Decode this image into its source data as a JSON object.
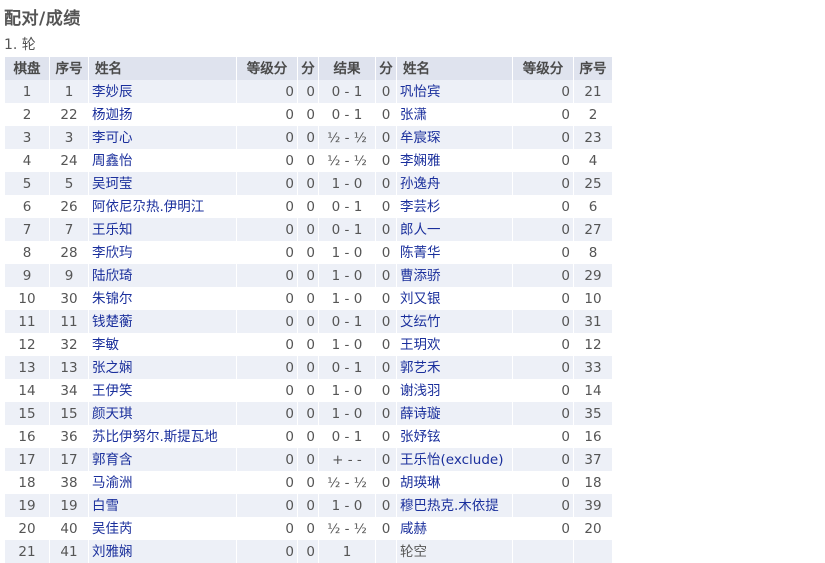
{
  "page_title": "配对/成绩",
  "round_label": "1. 轮",
  "headers": [
    "棋盘",
    "序号",
    "姓名",
    "等级分",
    "分",
    "结果",
    "分",
    "姓名",
    "等级分",
    "序号"
  ],
  "rows": [
    {
      "board": "1",
      "no1": "1",
      "name1": "李妙辰",
      "rating1": "0",
      "pts1": "0",
      "result": "0 - 1",
      "pts2": "0",
      "name2": "巩怡宾",
      "rating2": "0",
      "no2": "21"
    },
    {
      "board": "2",
      "no1": "22",
      "name1": "杨迦扬",
      "rating1": "0",
      "pts1": "0",
      "result": "0 - 1",
      "pts2": "0",
      "name2": "张潇",
      "rating2": "0",
      "no2": "2"
    },
    {
      "board": "3",
      "no1": "3",
      "name1": "李可心",
      "rating1": "0",
      "pts1": "0",
      "result": "½ - ½",
      "pts2": "0",
      "name2": "牟宸琛",
      "rating2": "0",
      "no2": "23"
    },
    {
      "board": "4",
      "no1": "24",
      "name1": "周鑫怡",
      "rating1": "0",
      "pts1": "0",
      "result": "½ - ½",
      "pts2": "0",
      "name2": "李娴雅",
      "rating2": "0",
      "no2": "4"
    },
    {
      "board": "5",
      "no1": "5",
      "name1": "吴珂莹",
      "rating1": "0",
      "pts1": "0",
      "result": "1 - 0",
      "pts2": "0",
      "name2": "孙逸舟",
      "rating2": "0",
      "no2": "25"
    },
    {
      "board": "6",
      "no1": "26",
      "name1": "阿依尼尕热.伊明江",
      "rating1": "0",
      "pts1": "0",
      "result": "0 - 1",
      "pts2": "0",
      "name2": "李芸杉",
      "rating2": "0",
      "no2": "6"
    },
    {
      "board": "7",
      "no1": "7",
      "name1": "王乐知",
      "rating1": "0",
      "pts1": "0",
      "result": "0 - 1",
      "pts2": "0",
      "name2": "郎人一",
      "rating2": "0",
      "no2": "27"
    },
    {
      "board": "8",
      "no1": "28",
      "name1": "李欣玙",
      "rating1": "0",
      "pts1": "0",
      "result": "1 - 0",
      "pts2": "0",
      "name2": "陈菁华",
      "rating2": "0",
      "no2": "8"
    },
    {
      "board": "9",
      "no1": "9",
      "name1": "陆欣琦",
      "rating1": "0",
      "pts1": "0",
      "result": "1 - 0",
      "pts2": "0",
      "name2": "曹添骄",
      "rating2": "0",
      "no2": "29"
    },
    {
      "board": "10",
      "no1": "30",
      "name1": "朱锦尔",
      "rating1": "0",
      "pts1": "0",
      "result": "1 - 0",
      "pts2": "0",
      "name2": "刘又银",
      "rating2": "0",
      "no2": "10"
    },
    {
      "board": "11",
      "no1": "11",
      "name1": "钱楚蘅",
      "rating1": "0",
      "pts1": "0",
      "result": "0 - 1",
      "pts2": "0",
      "name2": "艾纭竹",
      "rating2": "0",
      "no2": "31"
    },
    {
      "board": "12",
      "no1": "32",
      "name1": "李敏",
      "rating1": "0",
      "pts1": "0",
      "result": "1 - 0",
      "pts2": "0",
      "name2": "王玥欢",
      "rating2": "0",
      "no2": "12"
    },
    {
      "board": "13",
      "no1": "13",
      "name1": "张之娴",
      "rating1": "0",
      "pts1": "0",
      "result": "0 - 1",
      "pts2": "0",
      "name2": "郭艺禾",
      "rating2": "0",
      "no2": "33"
    },
    {
      "board": "14",
      "no1": "34",
      "name1": "王伊笑",
      "rating1": "0",
      "pts1": "0",
      "result": "1 - 0",
      "pts2": "0",
      "name2": "谢浅羽",
      "rating2": "0",
      "no2": "14"
    },
    {
      "board": "15",
      "no1": "15",
      "name1": "颜天琪",
      "rating1": "0",
      "pts1": "0",
      "result": "1 - 0",
      "pts2": "0",
      "name2": "薛诗璇",
      "rating2": "0",
      "no2": "35"
    },
    {
      "board": "16",
      "no1": "36",
      "name1": "苏比伊努尔.斯提瓦地",
      "rating1": "0",
      "pts1": "0",
      "result": "0 - 1",
      "pts2": "0",
      "name2": "张妤铉",
      "rating2": "0",
      "no2": "16"
    },
    {
      "board": "17",
      "no1": "17",
      "name1": "郭育含",
      "rating1": "0",
      "pts1": "0",
      "result": "+ - -",
      "pts2": "0",
      "name2": "王乐怡(exclude)",
      "rating2": "0",
      "no2": "37"
    },
    {
      "board": "18",
      "no1": "38",
      "name1": "马渝洲",
      "rating1": "0",
      "pts1": "0",
      "result": "½ - ½",
      "pts2": "0",
      "name2": "胡瑛琳",
      "rating2": "0",
      "no2": "18"
    },
    {
      "board": "19",
      "no1": "19",
      "name1": "白雪",
      "rating1": "0",
      "pts1": "0",
      "result": "1 - 0",
      "pts2": "0",
      "name2": "穆巴热克.木依提",
      "rating2": "0",
      "no2": "39"
    },
    {
      "board": "20",
      "no1": "40",
      "name1": "吴佳芮",
      "rating1": "0",
      "pts1": "0",
      "result": "½ - ½",
      "pts2": "0",
      "name2": "咸赫",
      "rating2": "0",
      "no2": "20"
    },
    {
      "board": "21",
      "no1": "41",
      "name1": "刘雅娴",
      "rating1": "0",
      "pts1": "0",
      "result": "1",
      "pts2": "",
      "name2": "轮空",
      "name2_link": false,
      "rating2": "",
      "no2": ""
    }
  ]
}
